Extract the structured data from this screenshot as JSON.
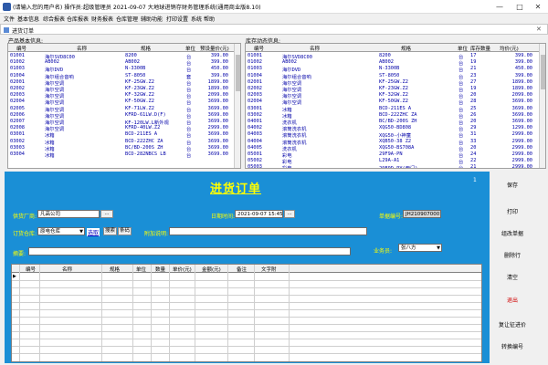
{
  "window": {
    "title": "(请输入您的用户名)    操作员:超级管理员    2021-09-07  大地球进销存财务管理系统(通用商业版8.10)",
    "minimize": "—",
    "maximize": "□",
    "close": "✕"
  },
  "menu": [
    "文件",
    "基本信息",
    "综合报表",
    "仓库报表",
    "财务报表",
    "仓库管理",
    "辅助功能",
    "打印设置",
    "系统",
    "帮助"
  ],
  "subwindow": {
    "title": "进货订单",
    "icon": "document-icon"
  },
  "product_section": {
    "label": "产品基本信息:",
    "columns": [
      "编号",
      "名称",
      "规格",
      "单位",
      "预设量价(元)"
    ],
    "rows": [
      [
        "01001",
        "海尔SVD8C00",
        "8200",
        "台",
        "399.00"
      ],
      [
        "01002",
        "AB002",
        "AB002",
        "台",
        "399.00"
      ],
      [
        "01003",
        "海尔DVD",
        "N-3300B",
        "台",
        "450.00"
      ],
      [
        "01004",
        "海尔组合音响",
        "ST-8050",
        "套",
        "399.00"
      ],
      [
        "02001",
        "海尔空调",
        "KF-25GW.Z2",
        "台",
        "1899.00"
      ],
      [
        "02002",
        "海尔空调",
        "KF-23GW.Z2",
        "台",
        "1899.00"
      ],
      [
        "02003",
        "海尔空调",
        "KF-32GW.Z2",
        "台",
        "2099.00"
      ],
      [
        "02004",
        "海尔空调",
        "KF-50GW.Z2",
        "台",
        "3699.00"
      ],
      [
        "02005",
        "海尔空调",
        "KF-71LW.Z2",
        "台",
        "3699.00"
      ],
      [
        "02006",
        "海尔空调",
        "KFRD-61LW.D(F)",
        "台",
        "3699.00"
      ],
      [
        "02007",
        "海尔空调",
        "KF-120LW.L新外观",
        "台",
        "3699.00"
      ],
      [
        "02008",
        "海尔空调",
        "KFRD-40LW.Z2",
        "台",
        "2999.00"
      ],
      [
        "03001",
        "冰箱",
        "BCD-211ES A",
        "台",
        "3699.00"
      ],
      [
        "03002",
        "冰箱",
        "BCD-222ZHC ZA",
        "台",
        "3699.00"
      ],
      [
        "03003",
        "冰箱",
        "BC/BD-200S ZH",
        "台",
        "3699.00"
      ],
      [
        "03004",
        "冰箱",
        "BCD-282NBCS LB",
        "台",
        "3699.00"
      ]
    ]
  },
  "stock_section": {
    "label": "库存动态信息:",
    "columns": [
      "编号",
      "名称",
      "规格",
      "单位",
      "库存数量",
      "均价(元)"
    ],
    "rows": [
      [
        "01001",
        "海尔SVD8C00",
        "8200",
        "台",
        "17",
        "399.00"
      ],
      [
        "01002",
        "AB002",
        "AB002",
        "台",
        "19",
        "399.00"
      ],
      [
        "01003",
        "海尔DVD",
        "N-3300B",
        "台",
        "21",
        "450.00"
      ],
      [
        "01004",
        "海尔组合音响",
        "ST-8050",
        "台",
        "23",
        "399.00"
      ],
      [
        "02001",
        "海尔空调",
        "KF-25GW.Z2",
        "台",
        "27",
        "1899.00"
      ],
      [
        "02002",
        "海尔空调",
        "KF-23GW.Z2",
        "台",
        "19",
        "1899.00"
      ],
      [
        "02003",
        "海尔空调",
        "KF-32GW.Z2",
        "台",
        "20",
        "2099.00"
      ],
      [
        "02004",
        "海尔空调",
        "KF-50GW.Z2",
        "台",
        "28",
        "3699.00"
      ],
      [
        "03001",
        "冰箱",
        "BCD-211ES A",
        "台",
        "25",
        "3699.00"
      ],
      [
        "03002",
        "冰箱",
        "BCD-222ZHC ZA",
        "台",
        "26",
        "3699.00"
      ],
      [
        "04001",
        "洗衣机",
        "BC/BD-200S ZH",
        "台",
        "20",
        "3699.00"
      ],
      [
        "04002",
        "滚筒洗衣机",
        "XQG50-BD808",
        "台",
        "29",
        "1299.00"
      ],
      [
        "04003",
        "滚筒洗衣机",
        "XQG50-小神童",
        "台",
        "31",
        "2999.00"
      ],
      [
        "04004",
        "滚筒洗衣机",
        "XQB50-38 Z2",
        "台",
        "33",
        "2999.00"
      ],
      [
        "04005",
        "洗衣机",
        "XQG50-BS708A",
        "台",
        "20",
        "2999.00"
      ],
      [
        "05001",
        "彩电",
        "29F9A-PN",
        "台",
        "24",
        "2999.00"
      ],
      [
        "05002",
        "彩电",
        "L29A-A1",
        "台",
        "22",
        "2999.00"
      ],
      [
        "05003",
        "彩电",
        "29F9D-PY(西门)",
        "台",
        "21",
        "2999.00"
      ]
    ]
  },
  "order": {
    "heading": "进货订单",
    "page_num": "1",
    "supplier_label": "供货厂商:",
    "supplier_value": "凡高公司",
    "browse": "...",
    "date_label": "日期时间:",
    "date_value": "2021-09-07 15:45:05",
    "date_browse": "...",
    "order_no_label": "单据编号:",
    "order_no_value": "JH2109070001",
    "warehouse_label": "订货仓库:",
    "warehouse_value": "原电仓库",
    "select_btn": "选取",
    "search_btn": "搜索",
    "barcode_btn": "条码",
    "addl_label": "附加说明:",
    "addl_value": "",
    "summary_label": "摘要:",
    "summary_value": "",
    "rep_label": "业务员:",
    "rep_value": "张八方",
    "grid_columns": [
      "编号",
      "名称",
      "规格",
      "单位",
      "数量",
      "单价(元)",
      "金额(元)",
      "备注",
      "文字附"
    ]
  },
  "right_buttons": [
    "保存",
    "打印",
    "组改单据",
    "删除行",
    "清空",
    "退出",
    "复让征进价",
    "转换编号"
  ],
  "colors": {
    "panel": "#1a8fd6",
    "title": "#ffff00",
    "exit": "#d00000"
  }
}
